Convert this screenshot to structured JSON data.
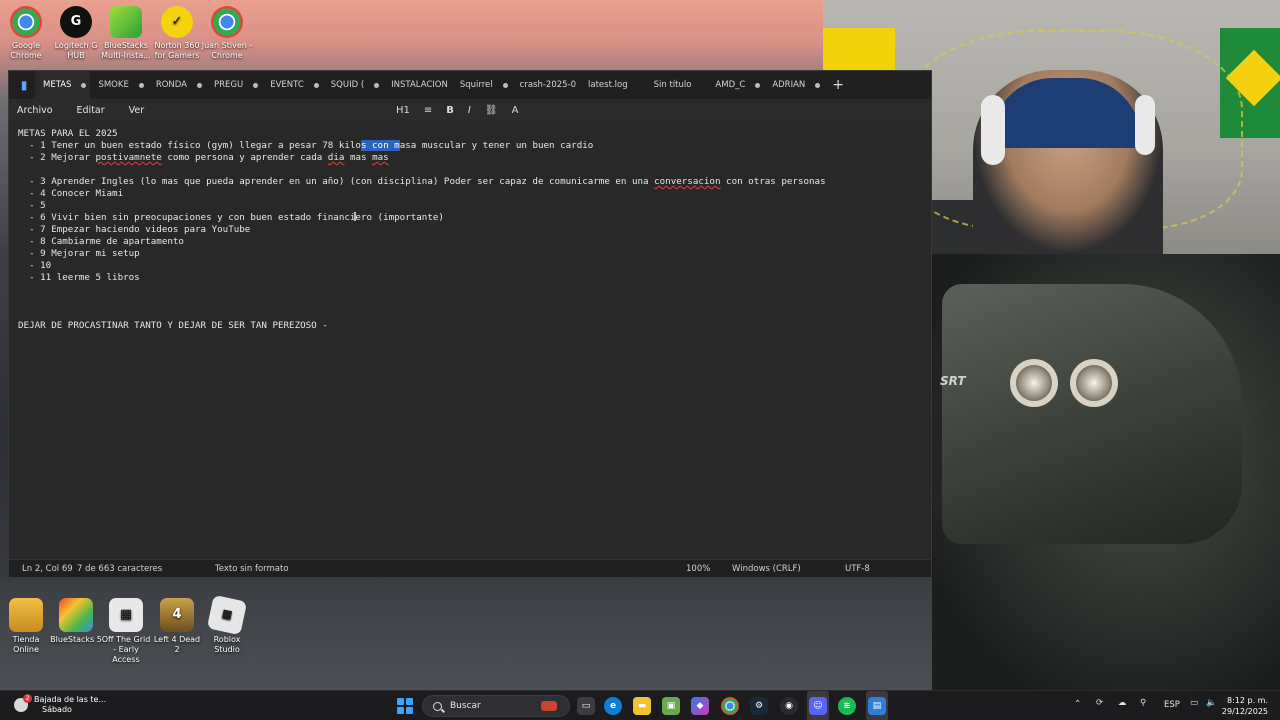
{
  "desktop_icons_top": [
    {
      "label": "Google Chrome",
      "icon": "chrome-icon",
      "color": "#2f8f3a"
    },
    {
      "label": "Logitech G HUB",
      "icon": "logitech-icon",
      "color": "#111111"
    },
    {
      "label": "BlueStacks Multi-Insta...",
      "icon": "bluestacks-icon",
      "color": "#49b33f"
    },
    {
      "label": "Norton 360 for Gamers",
      "icon": "norton-icon",
      "color": "#f4d30c"
    },
    {
      "label": "Juan Stiven - Chrome",
      "icon": "chrome-profile-icon",
      "color": "#2f8f3a"
    }
  ],
  "desktop_icons_bottom": [
    {
      "label": "Tienda Online",
      "icon": "store-icon",
      "color": "#d9a23b"
    },
    {
      "label": "BlueStacks 5",
      "icon": "bluestacks-icon",
      "color": "#49b33f"
    },
    {
      "label": "Off The Grid - Early Access",
      "icon": "game-icon",
      "color": "#333333"
    },
    {
      "label": "Left 4 Dead 2",
      "icon": "left4dead-icon",
      "color": "#8a6d2f"
    },
    {
      "label": "Roblox Studio",
      "icon": "roblox-icon",
      "color": "#2a2a2a"
    }
  ],
  "notepad": {
    "tabs": [
      "METAS",
      "SMOKE",
      "RONDA",
      "PREGU",
      "EVENTC",
      "SQUID (",
      "INSTALACION",
      "Squirrel",
      "crash-2025-0",
      "latest.log",
      "Sin título",
      "AMD_C",
      "ADRIAN"
    ],
    "new_tab": "+",
    "menu": [
      "Archivo",
      "Editar",
      "Ver"
    ],
    "toolbar": {
      "heading": "H1",
      "list": "≡",
      "bold": "B",
      "italic": "I",
      "link": "⛓",
      "spell": "A"
    },
    "content": {
      "l1": "METAS PARA EL 2025",
      "l2a": "  - 1 Tener un buen estado físico (gym) llegar a pesar 78 kilo",
      "l2sel": "s con m",
      "l2b": "asa muscular y tener un buen cardio",
      "l3a": "  - 2 Mejorar ",
      "l3spell": "postivamnete",
      "l3b": " como persona y aprender cada ",
      "l3spell2": "dia",
      "l3c": " mas ",
      "l3spell3": "mas",
      "l4": "",
      "l5a": "  - 3 Aprender Ingles (lo mas que pueda aprender en un año) (con disciplina) Poder ser capaz de comunicarme en una ",
      "l5spell": "conversacion",
      "l5b": " con otras personas",
      "l6": "  - 4 Conocer Miami",
      "l7": "  - 5",
      "l8": "  - 6 Vivir bien sin preocupaciones y con buen estado financiero (importante)",
      "l9": "  - 7 Empezar haciendo videos para YouTube",
      "l10": "  - 8 Cambiarme de apartamento",
      "l11": "  - 9 Mejorar mi setup",
      "l12": "  - 10",
      "l13": "  - 11 leerme 5 libros",
      "l17": "DEJAR DE PROCASTINAR TANTO Y DEJAR DE SER TAN PEREZOSO -"
    },
    "status": {
      "position": "Ln 2, Col 69",
      "chars": "7 de 663 caracteres",
      "format": "Texto sin formato",
      "zoom": "100%",
      "line_ending": "Windows (CRLF)",
      "encoding": "UTF-8"
    }
  },
  "car": {
    "badge": "SRT"
  },
  "taskbar": {
    "weather_title": "Bajada de las te...",
    "weather_sub": "Sábado",
    "search": "Buscar",
    "tray_lang": "ESP",
    "time": "8:12 p. m.",
    "date": "29/12/2025"
  }
}
